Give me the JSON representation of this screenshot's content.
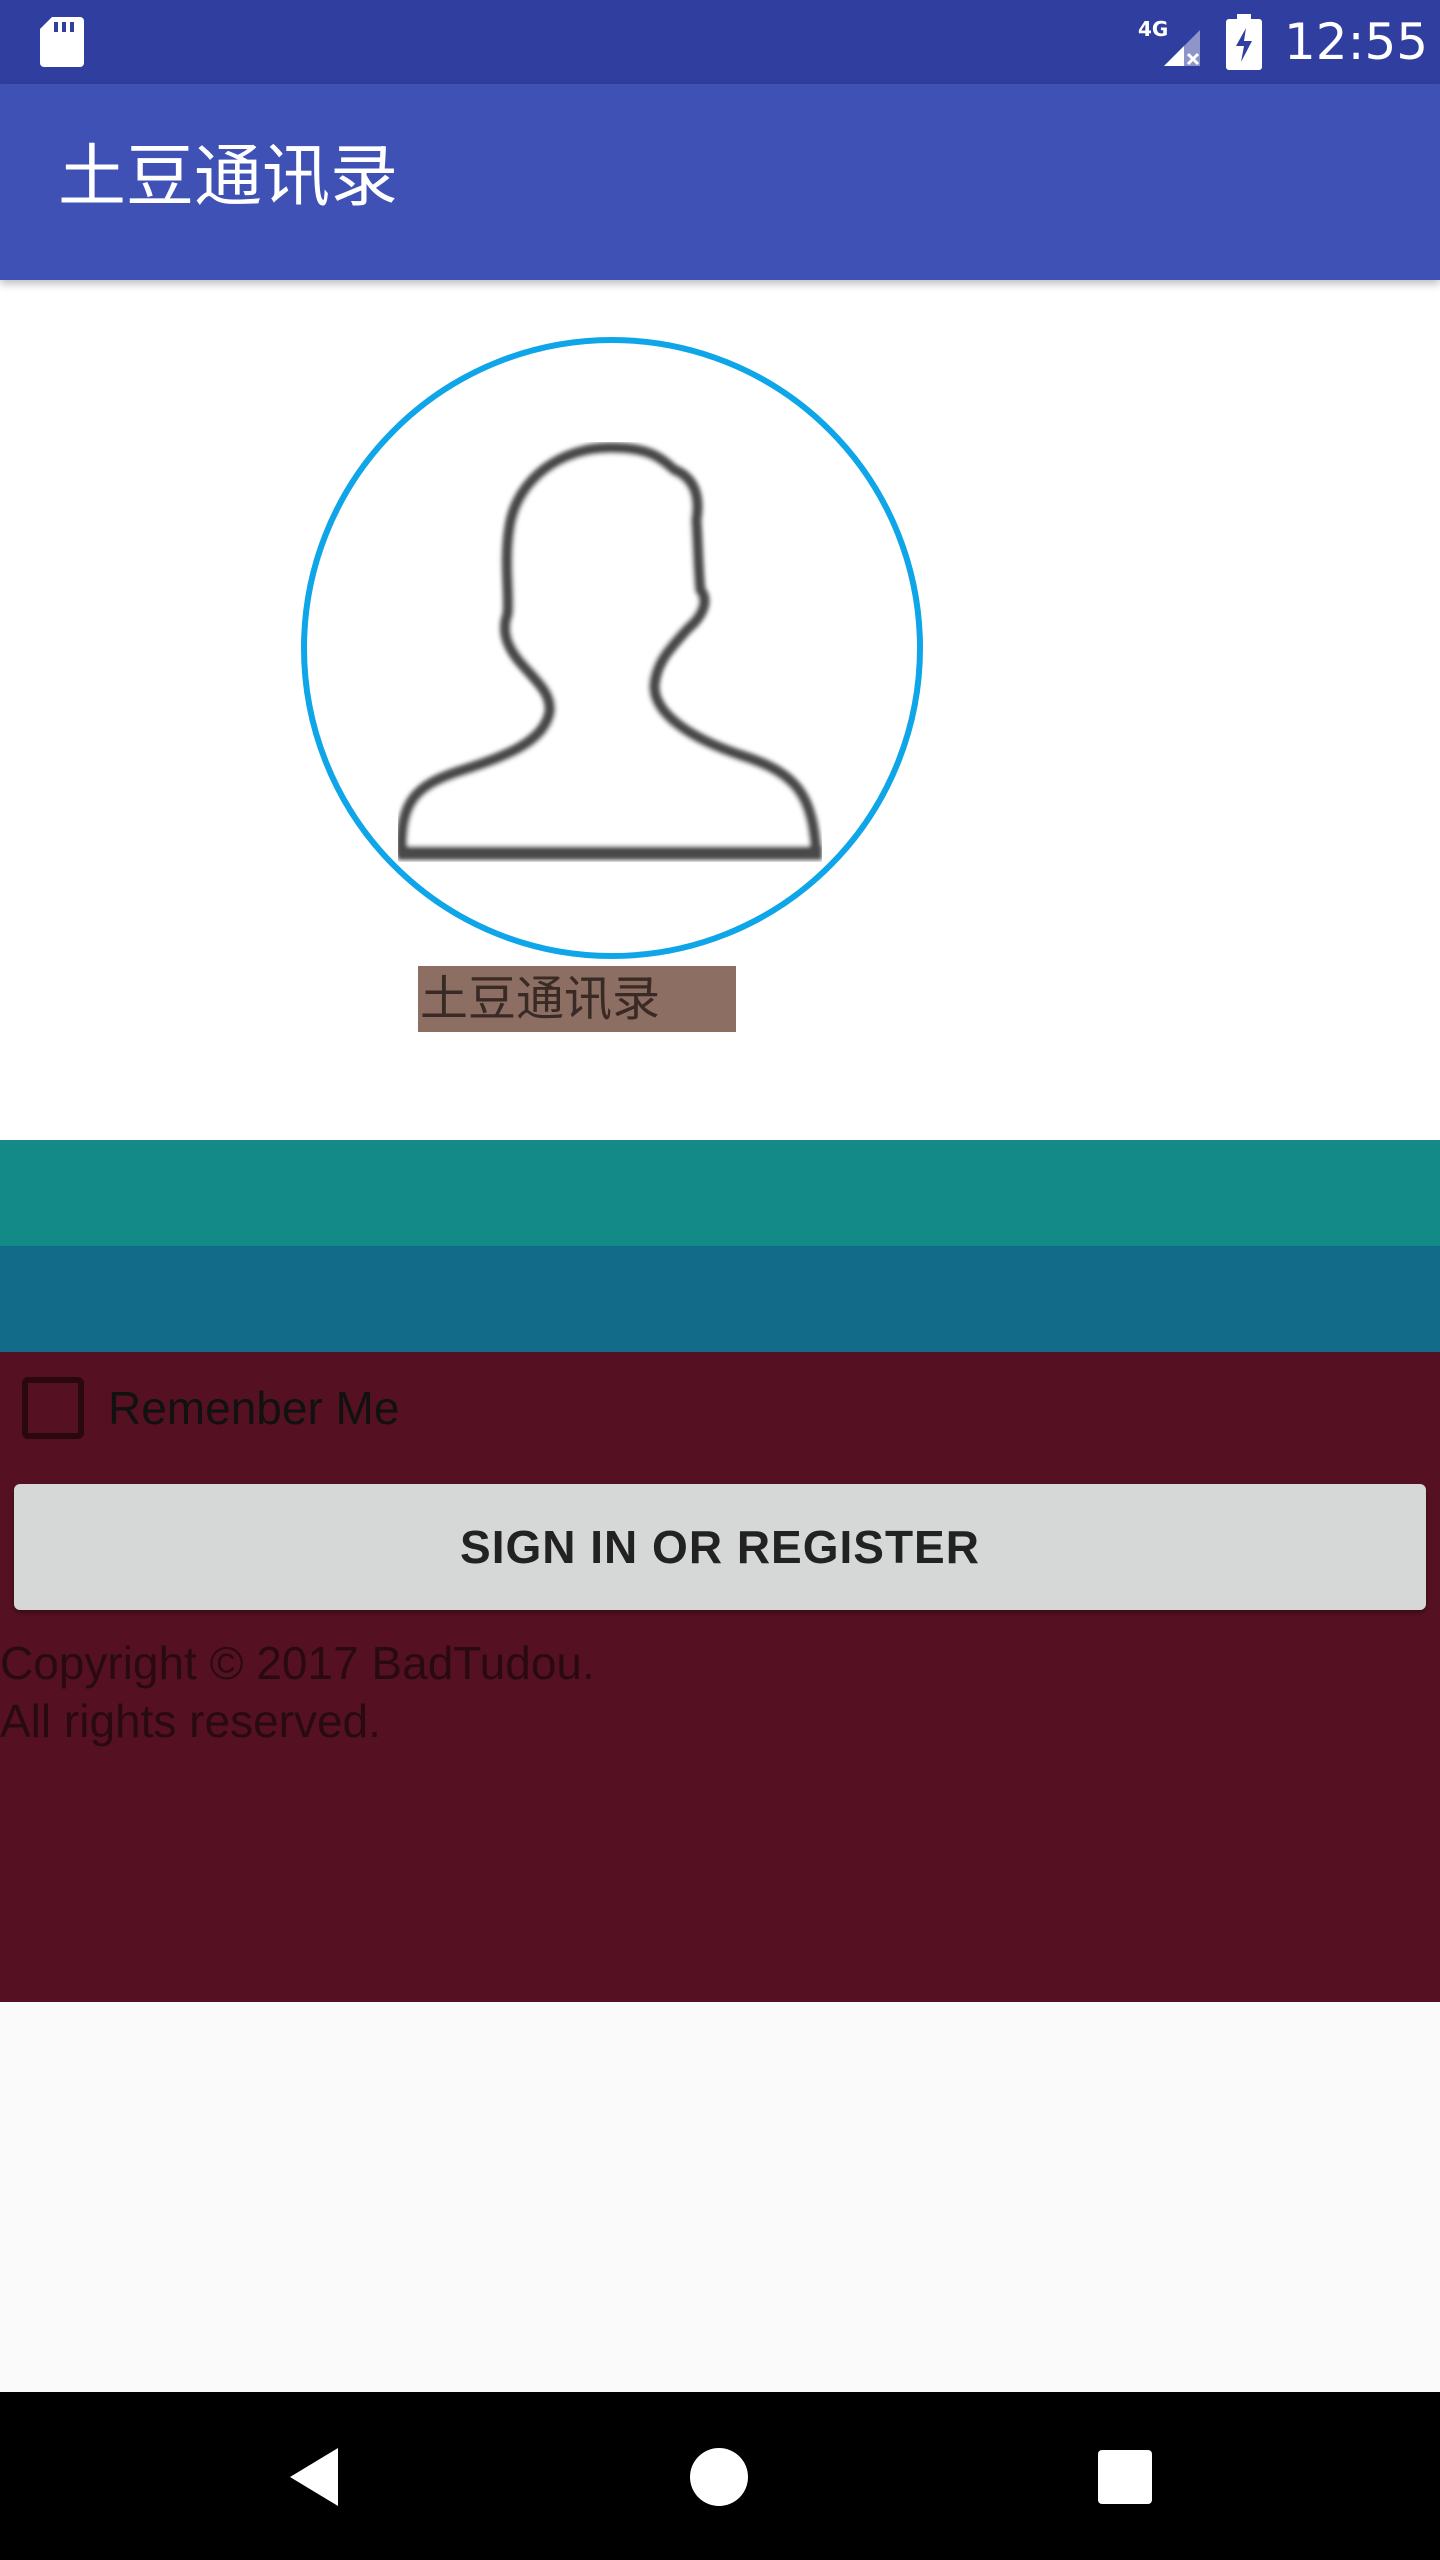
{
  "status_bar": {
    "time": "12:55",
    "network_label": "4G",
    "icons": [
      "sd-card-icon",
      "signal-4g-icon",
      "battery-charging-icon"
    ]
  },
  "app_bar": {
    "title": "土豆通讯录"
  },
  "profile": {
    "avatar_icon": "user-silhouette-icon",
    "app_name": "土豆通讯录"
  },
  "form": {
    "remember_me_label": "Remenber Me",
    "remember_me_checked": false,
    "signin_button_label": "SIGN IN OR REGISTER",
    "copyright_line1": "Copyright © 2017 BadTudou.",
    "copyright_line2": "All rights reserved."
  },
  "nav_bar": {
    "icons": [
      "back-icon",
      "home-icon",
      "recents-icon"
    ]
  },
  "colors": {
    "status_bar": "#303f9f",
    "app_bar": "#3f51b5",
    "avatar_ring": "#0ea5e9",
    "name_label_bg": "#8d6e63",
    "band_teal": "#138a88",
    "band_blue": "#136b8a",
    "form_panel": "#551122",
    "button": "#d6d7d7"
  }
}
